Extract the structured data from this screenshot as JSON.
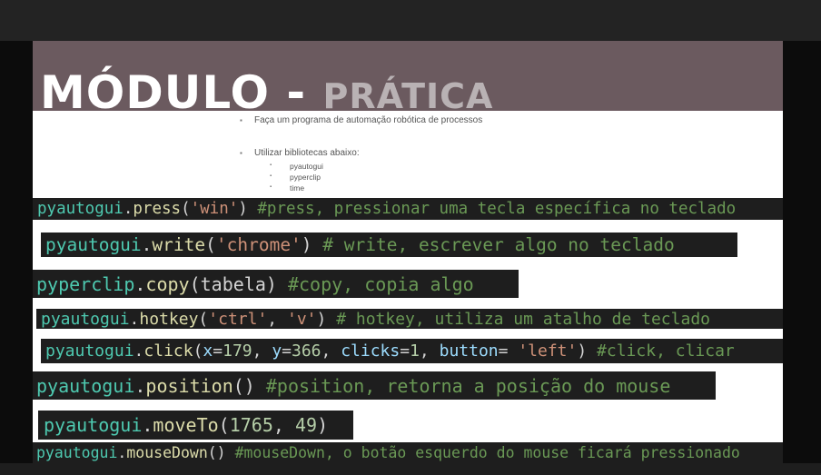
{
  "slide": {
    "title": "MÓDULO - ",
    "title_sub": "PRÁTICA",
    "bullets": [
      "Faça um programa de automação robótica de processos",
      "Utilizar bibliotecas abaixo:"
    ],
    "libraries": [
      "pyautogui",
      "pyperclip",
      "time"
    ]
  },
  "colors": {
    "module": "#4ec9b0",
    "function": "#dcdcaa",
    "string": "#ce9178",
    "comment": "#6a9955",
    "param": "#9cdcfe",
    "number": "#b5cea8",
    "text": "#d4d4d4"
  },
  "code_lines": [
    [
      [
        "m",
        "pyautogui"
      ],
      [
        "w",
        "."
      ],
      [
        "f",
        "press"
      ],
      [
        "w",
        "("
      ],
      [
        "s",
        "'win'"
      ],
      [
        "w",
        ") "
      ],
      [
        "c",
        "#press, pressionar uma tecla específica no teclado"
      ]
    ],
    [
      [
        "m",
        "pyautogui"
      ],
      [
        "w",
        "."
      ],
      [
        "f",
        "write"
      ],
      [
        "w",
        "("
      ],
      [
        "s",
        "'chrome'"
      ],
      [
        "w",
        ") "
      ],
      [
        "c",
        "# write, escrever algo no teclado"
      ]
    ],
    [
      [
        "m",
        "pyperclip"
      ],
      [
        "w",
        "."
      ],
      [
        "f",
        "copy"
      ],
      [
        "w",
        "(tabela) "
      ],
      [
        "c",
        "#copy, copia algo"
      ]
    ],
    [
      [
        "m",
        "pyautogui"
      ],
      [
        "w",
        "."
      ],
      [
        "f",
        "hotkey"
      ],
      [
        "w",
        "("
      ],
      [
        "s",
        "'ctrl'"
      ],
      [
        "w",
        ", "
      ],
      [
        "s",
        "'v'"
      ],
      [
        "w",
        ") "
      ],
      [
        "c",
        "# hotkey, utiliza um atalho de teclado"
      ]
    ],
    [
      [
        "m",
        "pyautogui"
      ],
      [
        "w",
        "."
      ],
      [
        "f",
        "click"
      ],
      [
        "w",
        "("
      ],
      [
        "p",
        "x"
      ],
      [
        "w",
        "="
      ],
      [
        "n",
        "179"
      ],
      [
        "w",
        ", "
      ],
      [
        "p",
        "y"
      ],
      [
        "w",
        "="
      ],
      [
        "n",
        "366"
      ],
      [
        "w",
        ", "
      ],
      [
        "p",
        "clicks"
      ],
      [
        "w",
        "="
      ],
      [
        "n",
        "1"
      ],
      [
        "w",
        ", "
      ],
      [
        "p",
        "button"
      ],
      [
        "w",
        "= "
      ],
      [
        "s",
        "'left'"
      ],
      [
        "w",
        ") "
      ],
      [
        "c",
        "#click, clicar"
      ]
    ],
    [
      [
        "m",
        "pyautogui"
      ],
      [
        "w",
        "."
      ],
      [
        "f",
        "position"
      ],
      [
        "w",
        "() "
      ],
      [
        "c",
        "#position, retorna a posição do mouse"
      ]
    ],
    [
      [
        "m",
        "pyautogui"
      ],
      [
        "w",
        "."
      ],
      [
        "f",
        "moveTo"
      ],
      [
        "w",
        "("
      ],
      [
        "n",
        "1765"
      ],
      [
        "w",
        ", "
      ],
      [
        "n",
        "49"
      ],
      [
        "w",
        ")"
      ]
    ],
    [
      [
        "m",
        "pyautogui"
      ],
      [
        "w",
        "."
      ],
      [
        "f",
        "mouseDown"
      ],
      [
        "w",
        "() "
      ],
      [
        "c",
        "#mouseDown, o botão esquerdo do mouse ficará pressionado"
      ]
    ]
  ]
}
